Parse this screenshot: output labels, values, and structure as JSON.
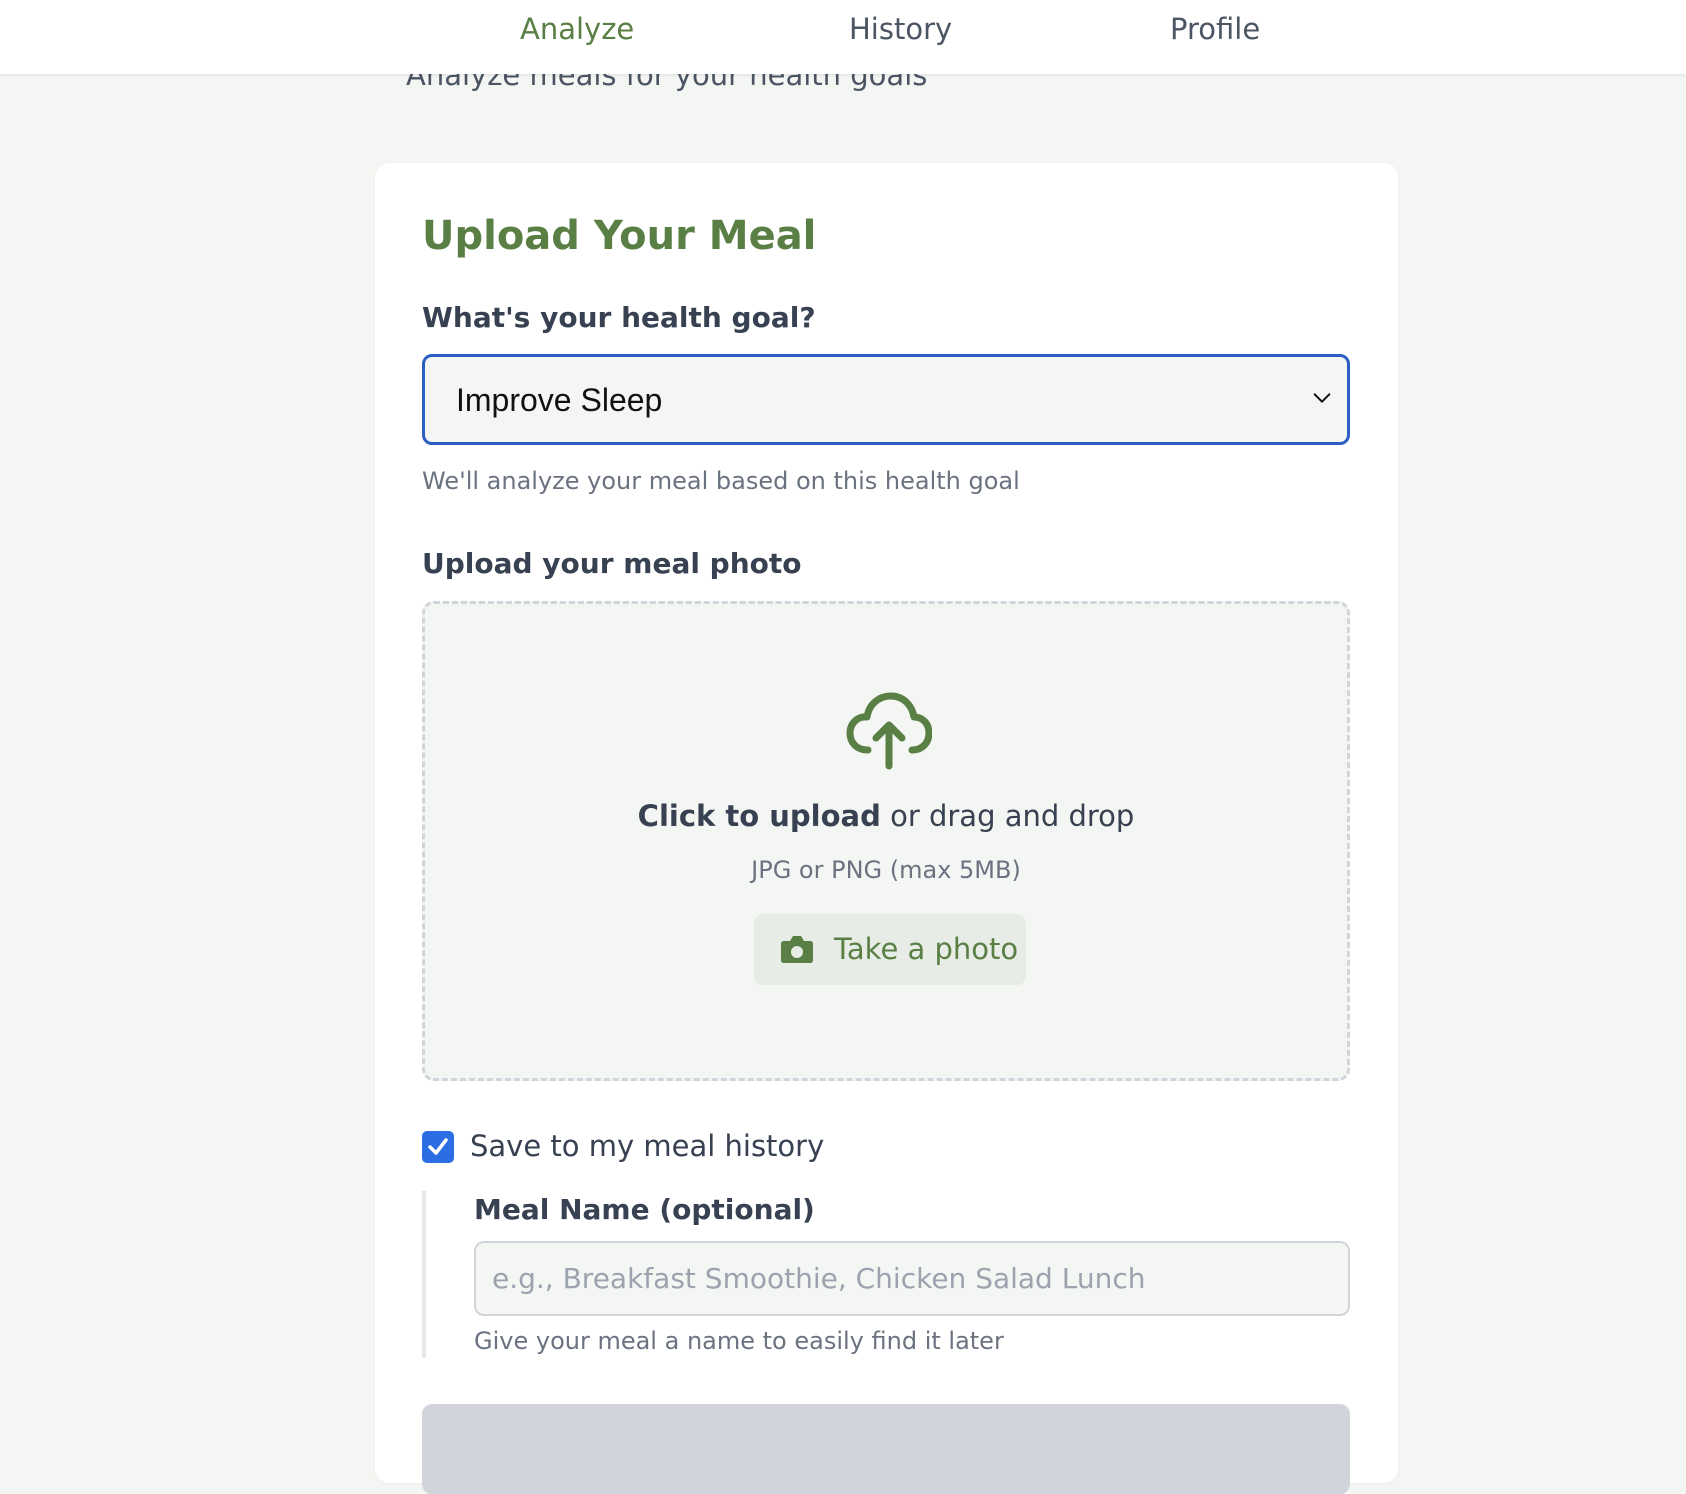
{
  "nav": {
    "items": [
      {
        "label": "Analyze",
        "active": true
      },
      {
        "label": "History",
        "active": false
      },
      {
        "label": "Profile",
        "active": false
      }
    ]
  },
  "header": {
    "subtitle": "Analyze meals for your health goals"
  },
  "form": {
    "title": "Upload Your Meal",
    "goal_label": "What's your health goal?",
    "goal_value": "Improve Sleep",
    "goal_help": "We'll analyze your meal based on this health goal",
    "photo_label": "Upload your meal photo",
    "dropzone": {
      "icon": "cloud-upload-icon",
      "cta_bold": "Click to upload",
      "cta_rest": "or drag and drop",
      "formats": "JPG or PNG (max 5MB)",
      "take_photo_label": "Take a photo",
      "take_photo_icon": "camera-icon"
    },
    "save_history_label": "Save to my meal history",
    "save_history_checked": true,
    "meal_name_label": "Meal Name (optional)",
    "meal_name_value": "",
    "meal_name_placeholder": "e.g., Breakfast Smoothie, Chicken Salad Lunch",
    "meal_name_help": "Give your meal a name to easily find it later"
  },
  "colors": {
    "brand_green": "#5a7f45",
    "focus_blue": "#2b5fc4",
    "checkbox_blue": "#2b6ee4",
    "page_bg": "#f4f6f3"
  }
}
